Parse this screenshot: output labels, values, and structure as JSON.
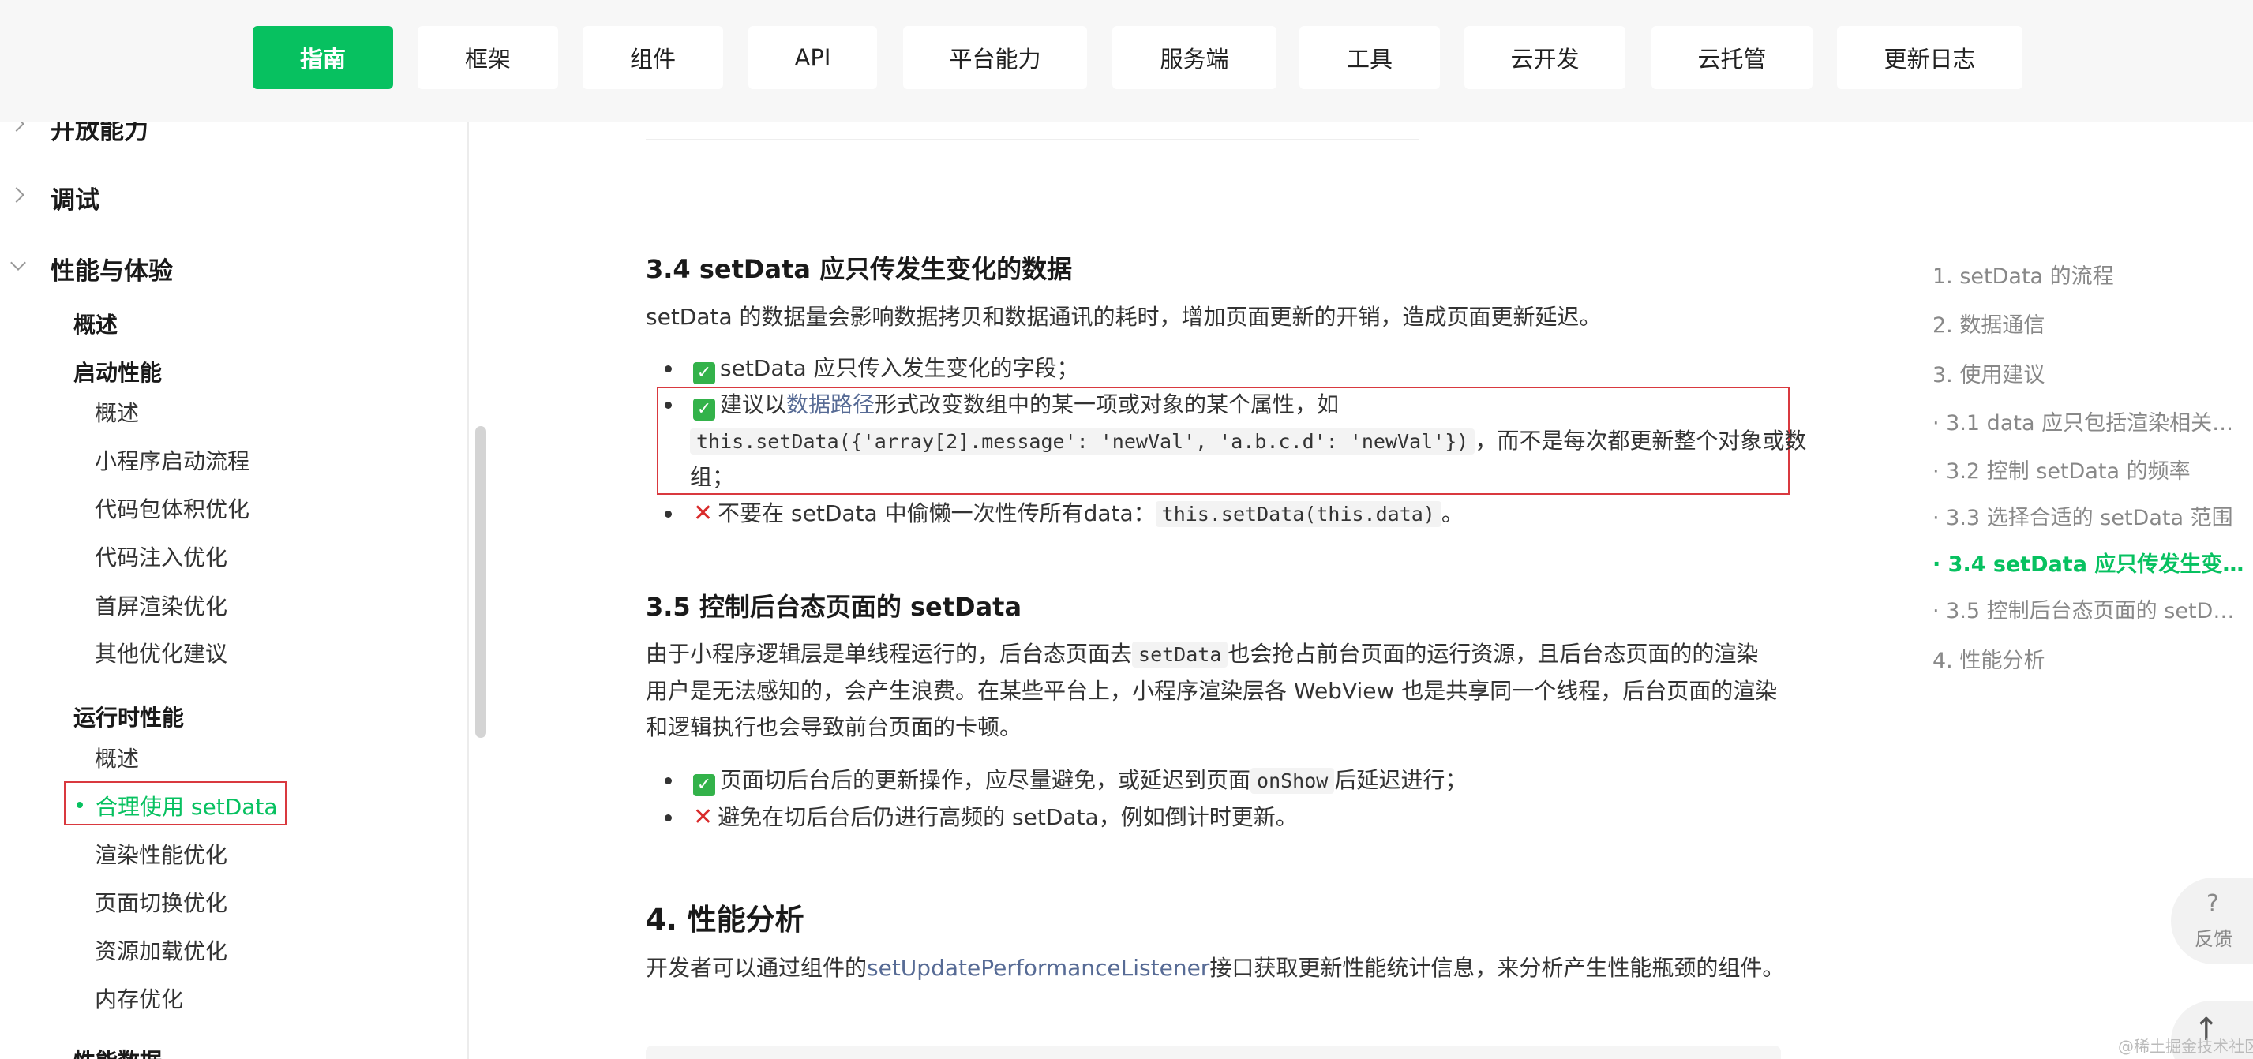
{
  "topnav": {
    "items": [
      {
        "label": "指南",
        "active": true
      },
      {
        "label": "框架"
      },
      {
        "label": "组件"
      },
      {
        "label": "API"
      },
      {
        "label": "平台能力"
      },
      {
        "label": "服务端"
      },
      {
        "label": "工具"
      },
      {
        "label": "云开发"
      },
      {
        "label": "云托管"
      },
      {
        "label": "更新日志"
      }
    ]
  },
  "sidebar": {
    "cut_top": "开放能力",
    "debug": "调试",
    "perf": "性能与体验",
    "overview": "概述",
    "startup": {
      "title": "启动性能",
      "items": [
        "概述",
        "小程序启动流程",
        "代码包体积优化",
        "代码注入优化",
        "首屏渲染优化",
        "其他优化建议"
      ]
    },
    "runtime": {
      "title": "运行时性能",
      "items": [
        "概述",
        "合理使用 setData",
        "渲染性能优化",
        "页面切换优化",
        "资源加载优化",
        "内存优化"
      ]
    },
    "cut_bottom": "性能数据"
  },
  "content": {
    "s34": {
      "title": "3.4 setData 应只传发生变化的数据",
      "para": "setData 的数据量会影响数据拷贝和数据通讯的耗时，增加页面更新的开销，造成页面更新延迟。",
      "b1": "setData 应只传入发生变化的字段；",
      "b2_pre": "建议以",
      "b2_link": "数据路径",
      "b2_post": "形式改变数组中的某一项或对象的某个属性，如",
      "b2_code": "this.setData({'array[2].message': 'newVal', 'a.b.c.d': 'newVal'})",
      "b2_tail": "，而不是每次都更新整个对象或数",
      "b2_last": "组；",
      "b3_pre": "不要在 setData 中偷懒一次性传所有data：",
      "b3_code": "this.setData(this.data)",
      "b3_post": "。"
    },
    "s35": {
      "title": "3.5 控制后台态页面的 setData",
      "p1_pre": "由于小程序逻辑层是单线程运行的，后台态页面去",
      "p1_code": "setData",
      "p1_post": "也会抢占前台页面的运行资源，且后台态页面的的渲染",
      "p2": "用户是无法感知的，会产生浪费。在某些平台上，小程序渲染层各 WebView 也是共享同一个线程，后台页面的渲染",
      "p3": "和逻辑执行也会导致前台页面的卡顿。",
      "b1_pre": "页面切后台后的更新操作，应尽量避免，或延迟到页面",
      "b1_code": "onShow",
      "b1_post": "后延迟进行；",
      "b2": "避免在切后台后仍进行高频的 setData，例如倒计时更新。"
    },
    "s4": {
      "title": "4. 性能分析",
      "pre": "开发者可以通过组件的",
      "link": "setUpdatePerformanceListener",
      "post": "接口获取更新性能统计信息，来分析产生性能瓶颈的组件。"
    }
  },
  "toc": [
    "1. setData 的流程",
    "2. 数据通信",
    "3. 使用建议",
    "· 3.1 data 应只包括渲染相关…",
    "· 3.2 控制 setData 的频率",
    "· 3.3 选择合适的 setData 范围",
    "· 3.4 setData 应只传发生变…",
    "· 3.5 控制后台态页面的 setD…",
    "4. 性能分析"
  ],
  "toc_active_index": 6,
  "feedback": {
    "icon": "?",
    "label": "反馈"
  },
  "watermark": "@稀土掘金技术社区",
  "colors": {
    "brand": "#07c160",
    "highlight_border": "#d9393f",
    "link": "#576b95"
  }
}
